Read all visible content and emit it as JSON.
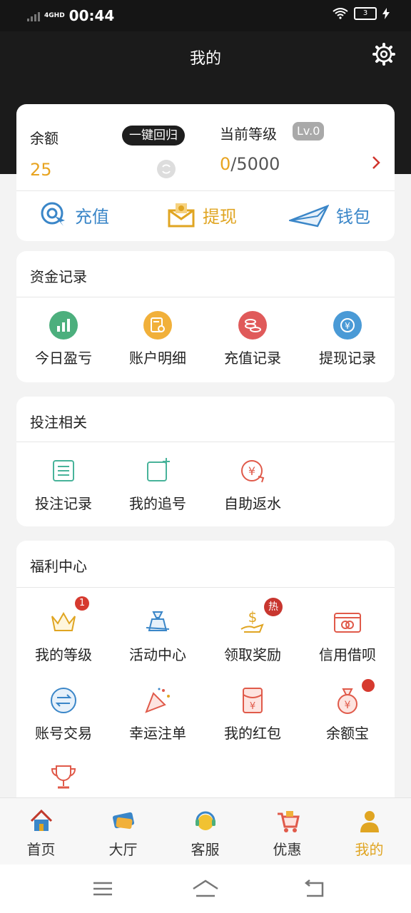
{
  "status": {
    "network": "4G",
    "network_sub": "HD",
    "time": "00:44",
    "battery": "3"
  },
  "header": {
    "title": "我的"
  },
  "account": {
    "balance_label": "余额",
    "one_key_return": "一键回归",
    "balance": "25",
    "level_label": "当前等级",
    "level_badge": "Lv.0",
    "progress_current": "0",
    "progress_total": "/5000"
  },
  "actions": [
    {
      "label": "充值",
      "icon": "recharge-icon",
      "color": "#3a86c8"
    },
    {
      "label": "提现",
      "icon": "withdraw-icon",
      "color": "#e0a522"
    },
    {
      "label": "钱包",
      "icon": "wallet-icon",
      "color": "#3a86c8"
    }
  ],
  "funds": {
    "title": "资金记录",
    "items": [
      {
        "label": "今日盈亏",
        "icon": "chart-icon",
        "color": "#4caf7d"
      },
      {
        "label": "账户明细",
        "icon": "detail-icon",
        "color": "#f1b03a"
      },
      {
        "label": "充值记录",
        "icon": "coins-icon",
        "color": "#e05a5a"
      },
      {
        "label": "提现记录",
        "icon": "withdraw-record-icon",
        "color": "#4a9ad6"
      }
    ]
  },
  "betting": {
    "title": "投注相关",
    "items": [
      {
        "label": "投注记录",
        "icon": "list-icon"
      },
      {
        "label": "我的追号",
        "icon": "add-square-icon"
      },
      {
        "label": "自助返水",
        "icon": "rebate-icon"
      }
    ]
  },
  "welfare": {
    "title": "福利中心",
    "items": [
      {
        "label": "我的等级",
        "icon": "crown-icon",
        "badge": "1"
      },
      {
        "label": "活动中心",
        "icon": "gift-bag-icon"
      },
      {
        "label": "领取奖励",
        "icon": "reward-icon",
        "badge": "热"
      },
      {
        "label": "信用借呗",
        "icon": "credit-card-icon"
      },
      {
        "label": "账号交易",
        "icon": "exchange-icon"
      },
      {
        "label": "幸运注单",
        "icon": "party-popper-icon"
      },
      {
        "label": "我的红包",
        "icon": "red-envelope-icon"
      },
      {
        "label": "余额宝",
        "icon": "money-bag-icon"
      }
    ]
  },
  "tabs": [
    {
      "label": "首页",
      "icon": "home-icon"
    },
    {
      "label": "大厅",
      "icon": "lobby-icon"
    },
    {
      "label": "客服",
      "icon": "support-icon"
    },
    {
      "label": "优惠",
      "icon": "cart-icon"
    },
    {
      "label": "我的",
      "icon": "profile-icon",
      "active": true
    }
  ],
  "colors": {
    "accent": "#e0a522",
    "header": "#1b1b1b",
    "alert": "#d63a2f",
    "blue": "#3a86c8"
  }
}
